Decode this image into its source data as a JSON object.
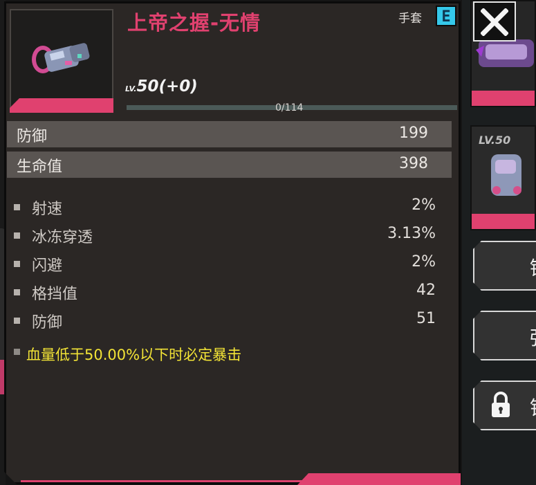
{
  "item": {
    "name": "上帝之握-无情",
    "slot": "手套",
    "grade": "E",
    "level_tag": "LV.",
    "level": "50(+0)",
    "xp_text": "0/114",
    "xp_progress": 0
  },
  "main_stats": [
    {
      "label": "防御",
      "value": "199"
    },
    {
      "label": "生命值",
      "value": "398"
    }
  ],
  "sub_stats": [
    {
      "label": "射速",
      "value": "2%"
    },
    {
      "label": "冰冻穿透",
      "value": "3.13%"
    },
    {
      "label": "闪避",
      "value": "2%"
    },
    {
      "label": "格挡值",
      "value": "42"
    },
    {
      "label": "防御",
      "value": "51"
    }
  ],
  "special_effect": "血量低于50.00%以下时必定暴击",
  "side": {
    "card_level_tag": "LV.50",
    "button_glyphs": [
      "锻",
      "强",
      "锁"
    ]
  },
  "colors": {
    "rarity": "#e0416f",
    "grade_badge": "#35c8ea",
    "special_text": "#f3e436",
    "panel": "#2b2725"
  },
  "icons": {
    "close": "close-x-icon",
    "item": "gauntlet-icon",
    "lock": "lock-icon"
  }
}
